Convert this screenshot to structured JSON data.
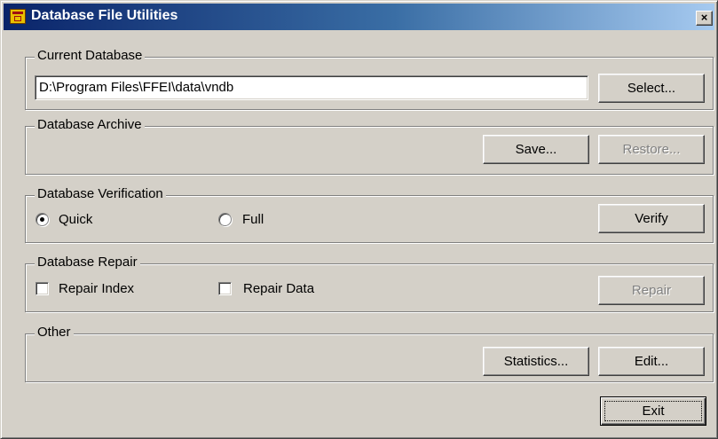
{
  "window": {
    "title": "Database File Utilities",
    "close_label": "×",
    "icon": "database-app-icon"
  },
  "current_database": {
    "legend": "Current Database",
    "path_value": "D:\\Program Files\\FFEI\\data\\vndb",
    "select_label": "Select..."
  },
  "archive": {
    "legend": "Database Archive",
    "save_label": "Save...",
    "restore_label": "Restore...",
    "restore_enabled": false
  },
  "verification": {
    "legend": "Database Verification",
    "options": [
      {
        "label": "Quick",
        "selected": true
      },
      {
        "label": "Full",
        "selected": false
      }
    ],
    "verify_label": "Verify"
  },
  "repair": {
    "legend": "Database Repair",
    "options": [
      {
        "label": "Repair Index",
        "checked": false
      },
      {
        "label": "Repair Data",
        "checked": false
      }
    ],
    "repair_label": "Repair",
    "repair_enabled": false
  },
  "other": {
    "legend": "Other",
    "statistics_label": "Statistics...",
    "edit_label": "Edit..."
  },
  "exit_label": "Exit",
  "colors": {
    "face": "#d4d0c8",
    "title_start": "#0a246a",
    "title_end": "#a6caf0",
    "disabled_text": "#808080"
  }
}
